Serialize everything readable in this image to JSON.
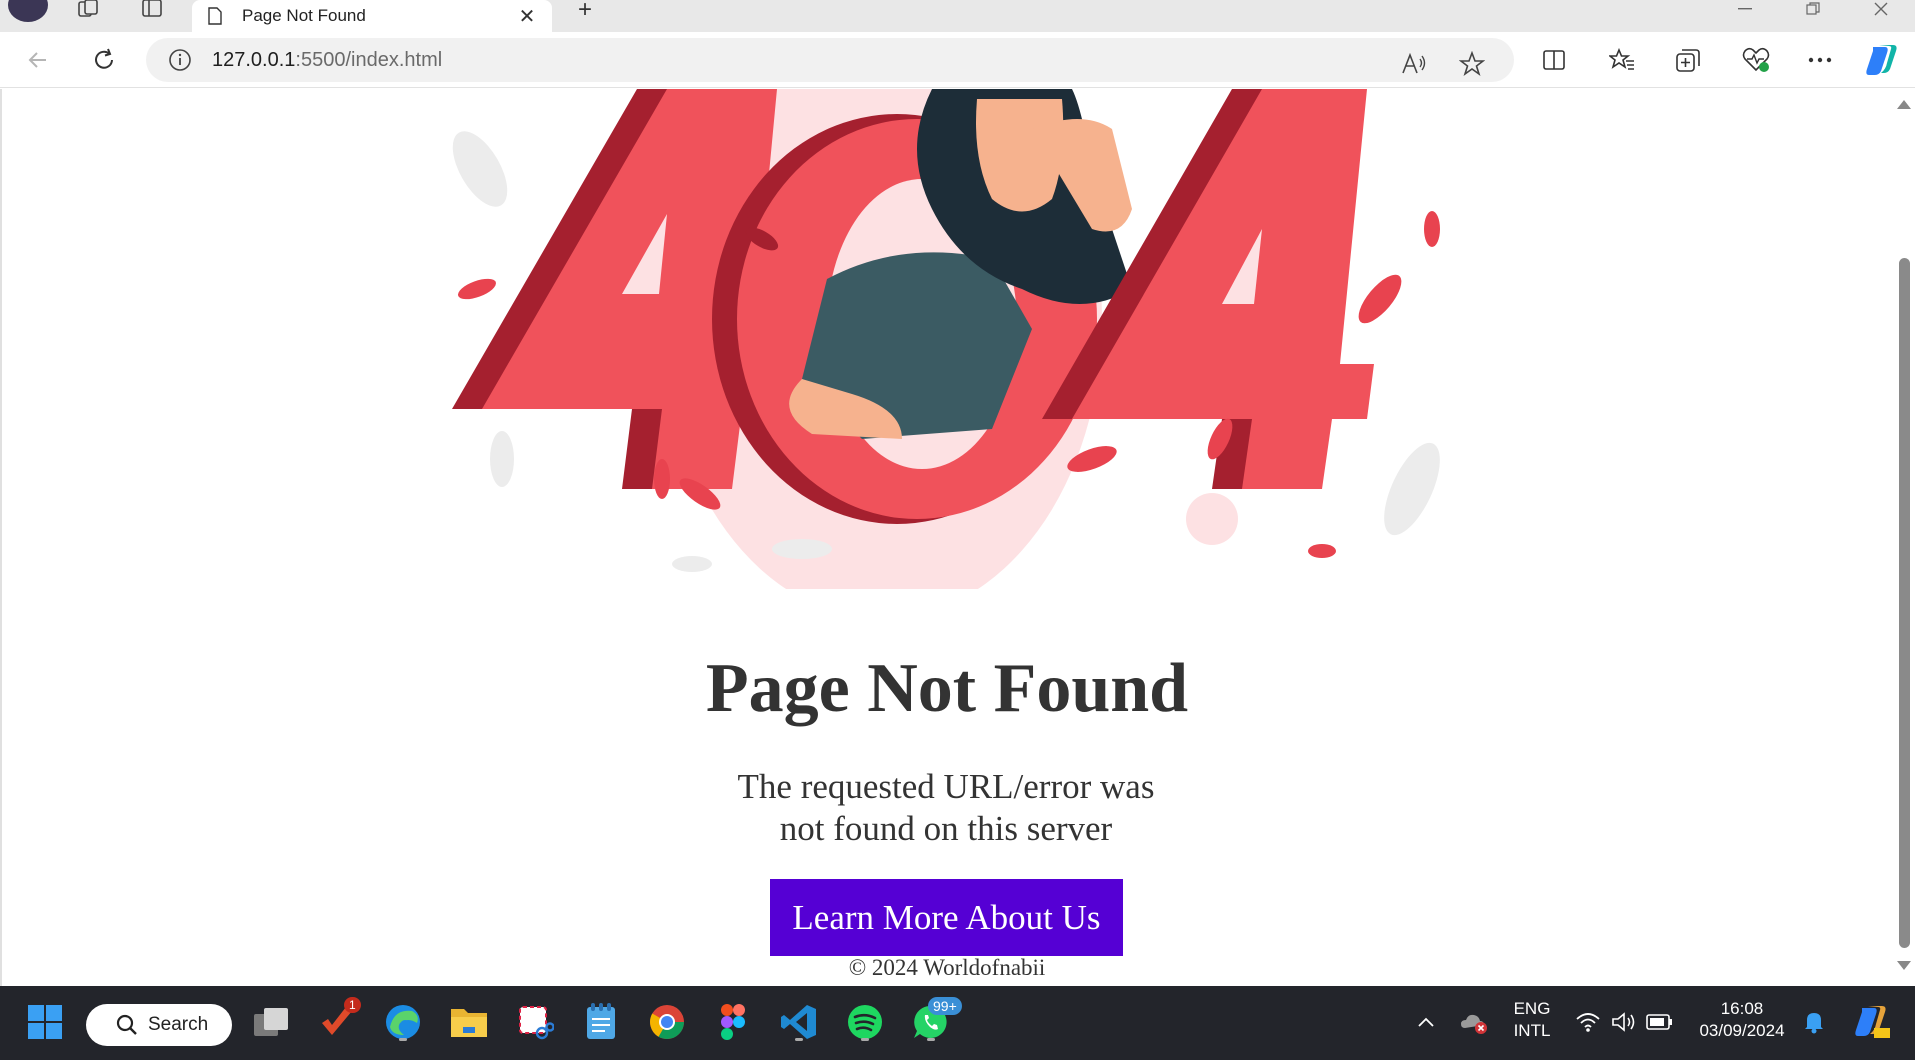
{
  "browser": {
    "tab": {
      "title": "Page Not Found"
    },
    "address": {
      "host": "127.0.0.1",
      "path": ":5500/index.html"
    }
  },
  "page": {
    "illustration_text": "404",
    "title": "Page Not Found",
    "message": "The requested URL/error was not found on this server",
    "cta_label": "Learn More About Us",
    "copyright": "© 2024 Worldofnabii",
    "colors": {
      "cta": "#5500d4",
      "digits": "#f0525b",
      "heading": "#333333"
    }
  },
  "taskbar": {
    "search_label": "Search",
    "badges": {
      "todo": "1",
      "whatsapp": "99+"
    },
    "language": {
      "lang": "ENG",
      "layout": "INTL"
    },
    "clock": {
      "time": "16:08",
      "date": "03/09/2024"
    },
    "pinned_icons": [
      "windows-start-icon",
      "task-view-icon",
      "todo-icon",
      "edge-icon",
      "file-explorer-icon",
      "snipping-tool-icon",
      "notepad-icon",
      "chrome-icon",
      "figma-icon",
      "vscode-icon",
      "spotify-icon",
      "whatsapp-icon"
    ]
  }
}
